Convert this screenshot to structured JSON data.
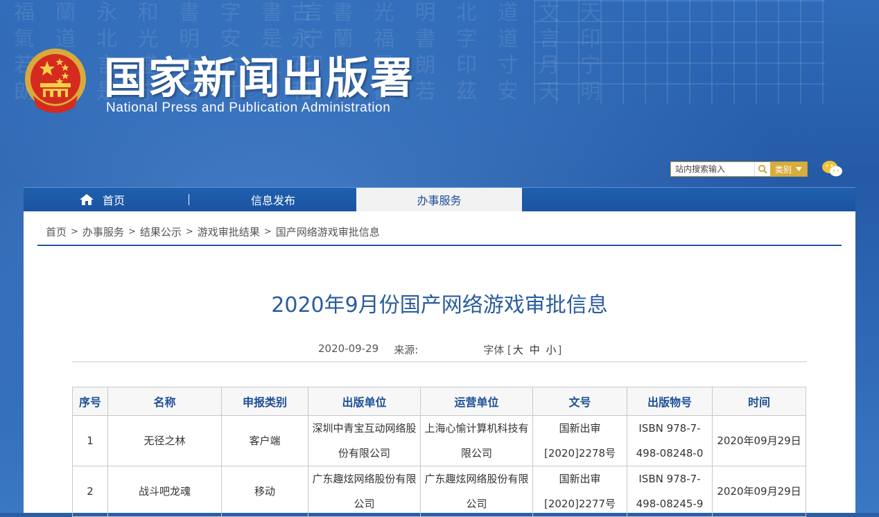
{
  "header": {
    "title": "国家新闻出版署",
    "subtitle": "National Press and Publication Administration",
    "search": {
      "placeholder": "站内搜索输入",
      "category_label": "类别"
    },
    "background_text_left": "福 蘭 永 和 書 字 書 言\n氣 道 北 光 明 安 是 宁\n若 茲 言 盛 方 方 文 印\n朗 觀 是 宁 石 寸 月 天",
    "background_text_right": "古 書 光 明 北 道 文 天\n永 蘭 福 書 字 道 言 印\n石 方 是 朗 印 寸 月 宁\n和 書 觀 若 茲 安 天 明"
  },
  "nav": {
    "home": "首页",
    "info": "信息发布",
    "service": "办事服务"
  },
  "breadcrumb": [
    "首页",
    "办事服务",
    "结果公示",
    "游戏审批结果",
    "国产网络游戏审批信息"
  ],
  "breadcrumb_sep": ">",
  "article": {
    "title": "2020年9月份国产网络游戏审批信息",
    "date": "2020-09-29",
    "source_label": "来源:",
    "font_label": "字体",
    "font_open": "[",
    "font_sizes": [
      "大",
      "中",
      "小"
    ],
    "font_close": "]"
  },
  "table": {
    "headers": [
      "序号",
      "名称",
      "申报类别",
      "出版单位",
      "运营单位",
      "文号",
      "出版物号",
      "时间"
    ],
    "rows": [
      {
        "no": "1",
        "name": "无径之林",
        "category": "客户端",
        "publisher": "深圳中青宝互动网络股份有限公司",
        "operator": "上海心愉计算机科技有限公司",
        "doc_no": "国新出审[2020]2278号",
        "isbn": "ISBN 978-7-498-08248-0",
        "date": "2020年09月29日"
      },
      {
        "no": "2",
        "name": "战斗吧龙魂",
        "category": "移动",
        "publisher": "广东趣炫网络股份有限公司",
        "operator": "广东趣炫网络股份有限公司",
        "doc_no": "国新出审[2020]2277号",
        "isbn": "ISBN 978-7-498-08245-9",
        "date": "2020年09月29日"
      }
    ]
  },
  "colors": {
    "banner_blue": "#2a5fa8",
    "nav_blue": "#1b54a0",
    "title_blue": "#2a5c9c",
    "gold": "#d8ac3d",
    "emblem_red": "#d52b1e"
  }
}
